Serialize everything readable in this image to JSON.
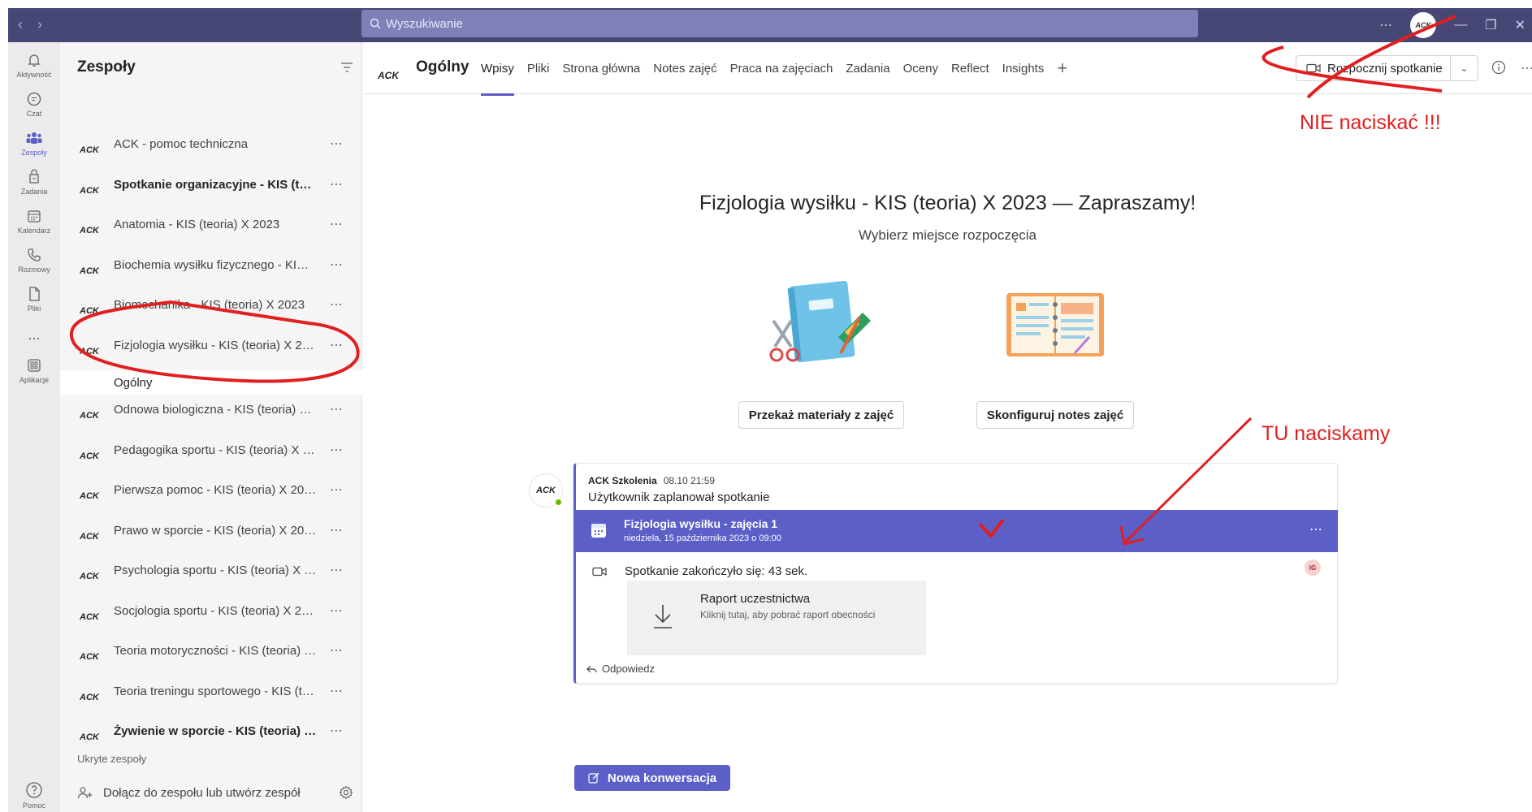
{
  "titlebar": {
    "search_placeholder": "Wyszukiwanie",
    "avatar_text": "ACK"
  },
  "rail": {
    "items": [
      {
        "label": "Aktywność",
        "icon": "bell-icon"
      },
      {
        "label": "Czat",
        "icon": "chat-icon"
      },
      {
        "label": "Zespoły",
        "icon": "teams-icon",
        "active": true
      },
      {
        "label": "Zadania",
        "icon": "assignments-icon"
      },
      {
        "label": "Kalendarz",
        "icon": "calendar-icon"
      },
      {
        "label": "Rozmowy",
        "icon": "phone-icon"
      },
      {
        "label": "Pliki",
        "icon": "file-icon"
      },
      {
        "label": "...",
        "icon": "more-icon"
      },
      {
        "label": "Aplikacje",
        "icon": "apps-icon"
      },
      {
        "label": "Pomoc",
        "icon": "help-icon"
      }
    ]
  },
  "panel": {
    "title": "Zespoły",
    "teams": [
      {
        "name": "ACK - pomoc techniczna",
        "bold": false
      },
      {
        "name": "Spotkanie organizacyjne - KIS (teo...",
        "bold": true
      },
      {
        "name": "Anatomia - KIS (teoria) X 2023",
        "bold": false
      },
      {
        "name": "Biochemia wysiłku fizycznego - KIS (t...",
        "bold": false
      },
      {
        "name": "Biomechanika - KIS (teoria) X 2023",
        "bold": false
      },
      {
        "name": "Fizjologia wysiłku - KIS (teoria) X 2023",
        "bold": false
      },
      {
        "name": "Odnowa biologiczna - KIS (teoria) X 2...",
        "bold": false
      },
      {
        "name": "Pedagogika sportu - KIS (teoria) X 20...",
        "bold": false
      },
      {
        "name": "Pierwsza pomoc - KIS (teoria) X 2023",
        "bold": false
      },
      {
        "name": "Prawo w sporcie - KIS (teoria) X 2023",
        "bold": false
      },
      {
        "name": "Psychologia sportu - KIS (teoria) X 20...",
        "bold": false
      },
      {
        "name": "Socjologia sportu - KIS (teoria) X 2023",
        "bold": false
      },
      {
        "name": "Teoria motoryczności - KIS (teoria) X ...",
        "bold": false
      },
      {
        "name": "Teoria treningu sportowego - KIS (teo...",
        "bold": false
      },
      {
        "name": "Żywienie w sporcie - KIS (teoria) X ...",
        "bold": true
      }
    ],
    "active_channel": "Ogólny",
    "hidden_label": "Ukryte zespoły",
    "join_label": "Dołącz do zespołu lub utwórz zespół"
  },
  "header": {
    "channel_title": "Ogólny",
    "logo_text": "ACK",
    "tabs": [
      "Wpisy",
      "Pliki",
      "Strona główna",
      "Notes zajęć",
      "Praca na zajęciach",
      "Zadania",
      "Oceny",
      "Reflect",
      "Insights"
    ],
    "meet_button": "Rozpocznij spotkanie"
  },
  "annotations": {
    "do_not_press": "NIE naciskać !!!",
    "press_here": "TU naciskamy",
    "color": "#e02020"
  },
  "welcome": {
    "title": "Fizjologia wysiłku - KIS (teoria) X 2023 — Zapraszamy!",
    "subtitle": "Wybierz miejsce rozpoczęcia",
    "button_materials": "Przekaż materiały z zajęć",
    "button_notes": "Skonfiguruj notes zajęć"
  },
  "post": {
    "author": "ACK Szkolenia",
    "time": "08.10 21:59",
    "text": "Użytkownik zaplanował spotkanie",
    "event_title": "Fizjologia wysiłku - zajęcia 1",
    "event_date": "niedziela, 15 października 2023 o 09:00",
    "meeting_ended": "Spotkanie zakończyło się: 43 sek.",
    "participant_initials": "IG",
    "report_title": "Raport uczestnictwa",
    "report_subtitle": "Kliknij tutaj, aby pobrać raport obecności",
    "reply": "Odpowiedz"
  },
  "new_conversation": "Nowa konwersacja",
  "colors": {
    "accent": "#5b5fc7",
    "titlebar": "#464775",
    "annotation": "#e02020"
  }
}
